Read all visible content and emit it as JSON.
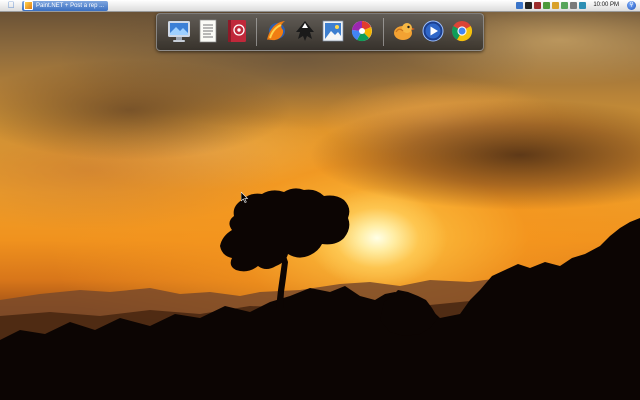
{
  "menubar": {
    "active_window_title": "Paint.NET + Post a rep ...",
    "clock": "10:00 PM",
    "tray_icons": [
      "network-icon",
      "battery-icon",
      "volume-icon",
      "app-tray-icon-1",
      "app-tray-icon-2",
      "app-tray-icon-3",
      "app-tray-icon-4",
      "app-tray-icon-5"
    ]
  },
  "dock": {
    "groups": [
      [
        "computer-icon",
        "document-icon",
        "address-book-icon"
      ],
      [
        "firefox-icon",
        "inkscape-icon",
        "image-viewer-icon",
        "picasa-icon"
      ],
      [
        "bird-chat-icon",
        "media-player-icon",
        "chrome-icon"
      ]
    ]
  },
  "wallpaper": {
    "subject": "sunset-tree-silhouette"
  },
  "colors": {
    "menubar_bg": "#e8e8e8",
    "title_highlight": "#3a6fc0",
    "sky_orange": "#f0921e",
    "sun": "#fff6d0",
    "silhouette": "#0c0503"
  }
}
